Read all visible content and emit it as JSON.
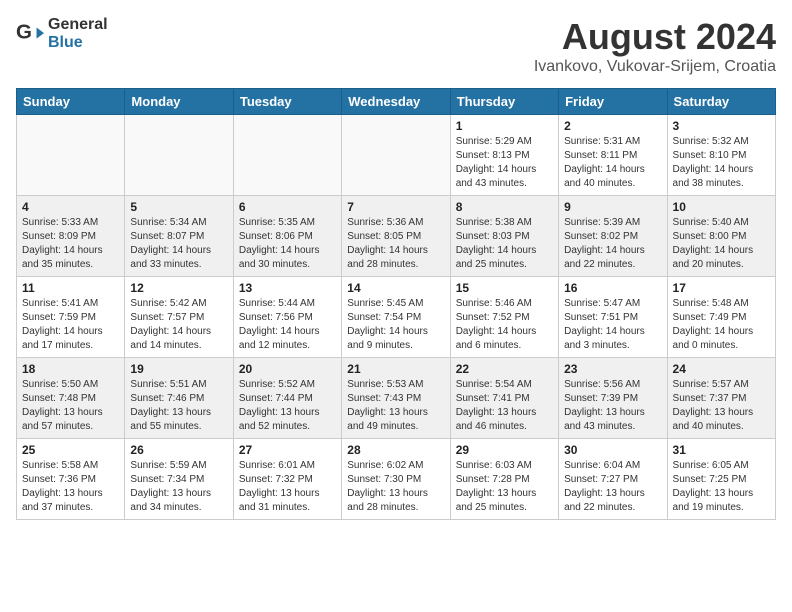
{
  "header": {
    "logo": {
      "general": "General",
      "blue": "Blue"
    },
    "title": "August 2024",
    "location": "Ivankovo, Vukovar-Srijem, Croatia"
  },
  "days_of_week": [
    "Sunday",
    "Monday",
    "Tuesday",
    "Wednesday",
    "Thursday",
    "Friday",
    "Saturday"
  ],
  "weeks": [
    [
      {
        "day": "",
        "empty": true
      },
      {
        "day": "",
        "empty": true
      },
      {
        "day": "",
        "empty": true
      },
      {
        "day": "",
        "empty": true
      },
      {
        "day": "1",
        "sunrise": "Sunrise: 5:29 AM",
        "sunset": "Sunset: 8:13 PM",
        "daylight": "Daylight: 14 hours and 43 minutes."
      },
      {
        "day": "2",
        "sunrise": "Sunrise: 5:31 AM",
        "sunset": "Sunset: 8:11 PM",
        "daylight": "Daylight: 14 hours and 40 minutes."
      },
      {
        "day": "3",
        "sunrise": "Sunrise: 5:32 AM",
        "sunset": "Sunset: 8:10 PM",
        "daylight": "Daylight: 14 hours and 38 minutes."
      }
    ],
    [
      {
        "day": "4",
        "sunrise": "Sunrise: 5:33 AM",
        "sunset": "Sunset: 8:09 PM",
        "daylight": "Daylight: 14 hours and 35 minutes."
      },
      {
        "day": "5",
        "sunrise": "Sunrise: 5:34 AM",
        "sunset": "Sunset: 8:07 PM",
        "daylight": "Daylight: 14 hours and 33 minutes."
      },
      {
        "day": "6",
        "sunrise": "Sunrise: 5:35 AM",
        "sunset": "Sunset: 8:06 PM",
        "daylight": "Daylight: 14 hours and 30 minutes."
      },
      {
        "day": "7",
        "sunrise": "Sunrise: 5:36 AM",
        "sunset": "Sunset: 8:05 PM",
        "daylight": "Daylight: 14 hours and 28 minutes."
      },
      {
        "day": "8",
        "sunrise": "Sunrise: 5:38 AM",
        "sunset": "Sunset: 8:03 PM",
        "daylight": "Daylight: 14 hours and 25 minutes."
      },
      {
        "day": "9",
        "sunrise": "Sunrise: 5:39 AM",
        "sunset": "Sunset: 8:02 PM",
        "daylight": "Daylight: 14 hours and 22 minutes."
      },
      {
        "day": "10",
        "sunrise": "Sunrise: 5:40 AM",
        "sunset": "Sunset: 8:00 PM",
        "daylight": "Daylight: 14 hours and 20 minutes."
      }
    ],
    [
      {
        "day": "11",
        "sunrise": "Sunrise: 5:41 AM",
        "sunset": "Sunset: 7:59 PM",
        "daylight": "Daylight: 14 hours and 17 minutes."
      },
      {
        "day": "12",
        "sunrise": "Sunrise: 5:42 AM",
        "sunset": "Sunset: 7:57 PM",
        "daylight": "Daylight: 14 hours and 14 minutes."
      },
      {
        "day": "13",
        "sunrise": "Sunrise: 5:44 AM",
        "sunset": "Sunset: 7:56 PM",
        "daylight": "Daylight: 14 hours and 12 minutes."
      },
      {
        "day": "14",
        "sunrise": "Sunrise: 5:45 AM",
        "sunset": "Sunset: 7:54 PM",
        "daylight": "Daylight: 14 hours and 9 minutes."
      },
      {
        "day": "15",
        "sunrise": "Sunrise: 5:46 AM",
        "sunset": "Sunset: 7:52 PM",
        "daylight": "Daylight: 14 hours and 6 minutes."
      },
      {
        "day": "16",
        "sunrise": "Sunrise: 5:47 AM",
        "sunset": "Sunset: 7:51 PM",
        "daylight": "Daylight: 14 hours and 3 minutes."
      },
      {
        "day": "17",
        "sunrise": "Sunrise: 5:48 AM",
        "sunset": "Sunset: 7:49 PM",
        "daylight": "Daylight: 14 hours and 0 minutes."
      }
    ],
    [
      {
        "day": "18",
        "sunrise": "Sunrise: 5:50 AM",
        "sunset": "Sunset: 7:48 PM",
        "daylight": "Daylight: 13 hours and 57 minutes."
      },
      {
        "day": "19",
        "sunrise": "Sunrise: 5:51 AM",
        "sunset": "Sunset: 7:46 PM",
        "daylight": "Daylight: 13 hours and 55 minutes."
      },
      {
        "day": "20",
        "sunrise": "Sunrise: 5:52 AM",
        "sunset": "Sunset: 7:44 PM",
        "daylight": "Daylight: 13 hours and 52 minutes."
      },
      {
        "day": "21",
        "sunrise": "Sunrise: 5:53 AM",
        "sunset": "Sunset: 7:43 PM",
        "daylight": "Daylight: 13 hours and 49 minutes."
      },
      {
        "day": "22",
        "sunrise": "Sunrise: 5:54 AM",
        "sunset": "Sunset: 7:41 PM",
        "daylight": "Daylight: 13 hours and 46 minutes."
      },
      {
        "day": "23",
        "sunrise": "Sunrise: 5:56 AM",
        "sunset": "Sunset: 7:39 PM",
        "daylight": "Daylight: 13 hours and 43 minutes."
      },
      {
        "day": "24",
        "sunrise": "Sunrise: 5:57 AM",
        "sunset": "Sunset: 7:37 PM",
        "daylight": "Daylight: 13 hours and 40 minutes."
      }
    ],
    [
      {
        "day": "25",
        "sunrise": "Sunrise: 5:58 AM",
        "sunset": "Sunset: 7:36 PM",
        "daylight": "Daylight: 13 hours and 37 minutes."
      },
      {
        "day": "26",
        "sunrise": "Sunrise: 5:59 AM",
        "sunset": "Sunset: 7:34 PM",
        "daylight": "Daylight: 13 hours and 34 minutes."
      },
      {
        "day": "27",
        "sunrise": "Sunrise: 6:01 AM",
        "sunset": "Sunset: 7:32 PM",
        "daylight": "Daylight: 13 hours and 31 minutes."
      },
      {
        "day": "28",
        "sunrise": "Sunrise: 6:02 AM",
        "sunset": "Sunset: 7:30 PM",
        "daylight": "Daylight: 13 hours and 28 minutes."
      },
      {
        "day": "29",
        "sunrise": "Sunrise: 6:03 AM",
        "sunset": "Sunset: 7:28 PM",
        "daylight": "Daylight: 13 hours and 25 minutes."
      },
      {
        "day": "30",
        "sunrise": "Sunrise: 6:04 AM",
        "sunset": "Sunset: 7:27 PM",
        "daylight": "Daylight: 13 hours and 22 minutes."
      },
      {
        "day": "31",
        "sunrise": "Sunrise: 6:05 AM",
        "sunset": "Sunset: 7:25 PM",
        "daylight": "Daylight: 13 hours and 19 minutes."
      }
    ]
  ]
}
